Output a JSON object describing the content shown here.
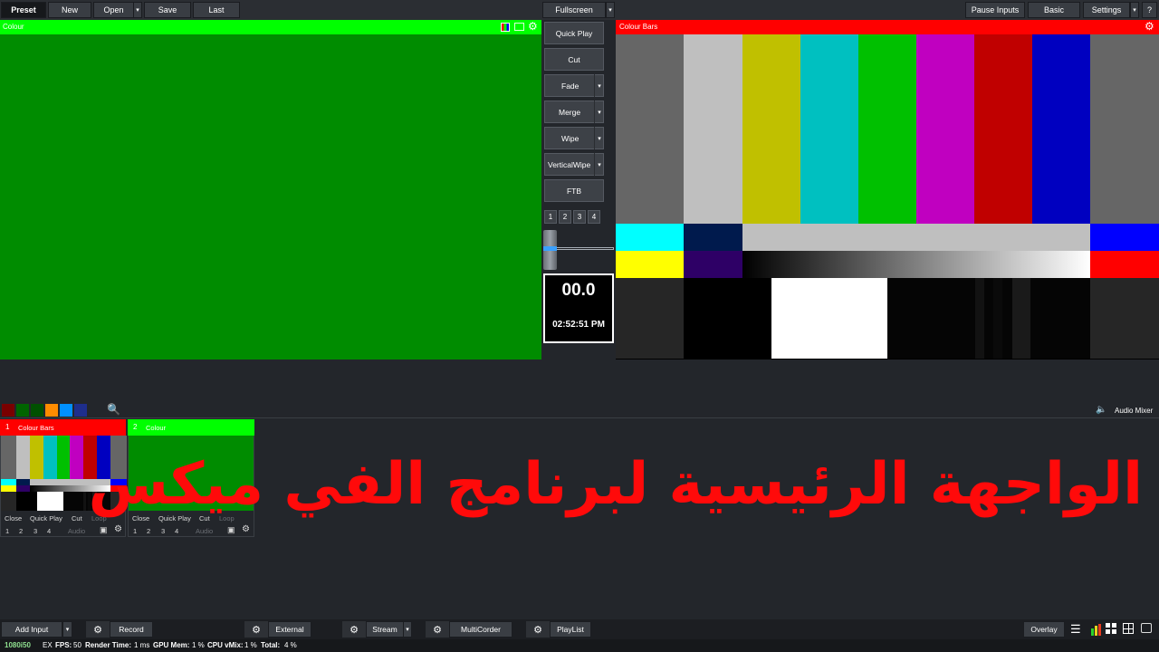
{
  "toolbar": {
    "preset": "Preset",
    "new": "New",
    "open": "Open",
    "save": "Save",
    "last": "Last",
    "fullscreen": "Fullscreen",
    "pause_inputs": "Pause Inputs",
    "basic": "Basic",
    "settings": "Settings",
    "help": "?"
  },
  "preview": {
    "title": "Colour",
    "color": "#008c00",
    "title_bar_color": "#00ff00"
  },
  "output": {
    "title": "Colour Bars",
    "title_bar_color": "#ff0000"
  },
  "transitions": {
    "quick_play": "Quick Play",
    "cut": "Cut",
    "fade": "Fade",
    "merge": "Merge",
    "wipe": "Wipe",
    "vertical_wipe": "VerticalWipe",
    "ftb": "FTB",
    "numbers": [
      "1",
      "2",
      "3",
      "4"
    ]
  },
  "timer": {
    "value": "00.0",
    "clock": "02:52:51 PM"
  },
  "colour_filters": [
    "#7a0000",
    "#006400",
    "#005000",
    "#ff8c00",
    "#0090ff",
    "#1e2e8c"
  ],
  "audio_mixer": {
    "label": "Audio Mixer"
  },
  "inputs": [
    {
      "number": "1",
      "name": "Colour Bars",
      "header_color": "#ff0000",
      "buttons": [
        "Close",
        "Quick Play",
        "Cut",
        "Loop"
      ],
      "numbers": [
        "1",
        "2",
        "3",
        "4"
      ],
      "audio": "Audio"
    },
    {
      "number": "2",
      "name": "Colour",
      "header_color": "#00ff00",
      "buttons": [
        "Close",
        "Quick Play",
        "Cut",
        "Loop"
      ],
      "numbers": [
        "1",
        "2",
        "3",
        "4"
      ],
      "audio": "Audio"
    }
  ],
  "overlay_title": "الواجهة الرئيسية لبرنامج الفي ميكس",
  "bottom": {
    "add_input": "Add Input",
    "record": "Record",
    "external": "External",
    "stream": "Stream",
    "multicorder": "MultiCorder",
    "playlist": "PlayList",
    "overlay": "Overlay"
  },
  "status": {
    "resolution": "1080i50",
    "ex": "EX",
    "fps_label": "FPS:",
    "fps": "50",
    "render_label": "Render Time:",
    "render": "1 ms",
    "gpu_label": "GPU Mem:",
    "gpu": "1 %",
    "cpu_label": "CPU vMix:",
    "cpu": "1 %",
    "total_label": "Total:",
    "total": "4 %"
  }
}
